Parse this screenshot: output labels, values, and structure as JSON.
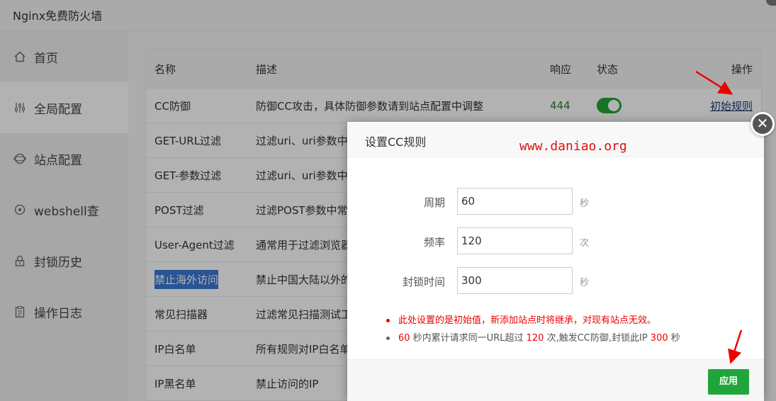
{
  "window": {
    "title": "Nginx免费防火墙"
  },
  "sidebar": {
    "items": [
      {
        "label": "首页",
        "icon": "home-icon"
      },
      {
        "label": "全局配置",
        "icon": "sliders-icon",
        "active": true
      },
      {
        "label": "站点配置",
        "icon": "globe-icon"
      },
      {
        "label": "webshell查",
        "icon": "crosshair-icon"
      },
      {
        "label": "封锁历史",
        "icon": "lock-history-icon"
      },
      {
        "label": "操作日志",
        "icon": "clipboard-icon"
      }
    ]
  },
  "table": {
    "headers": {
      "name": "名称",
      "desc": "描述",
      "resp": "响应",
      "state": "状态",
      "op": "操作"
    },
    "rows": [
      {
        "name": "CC防御",
        "desc": "防御CC攻击，具体防御参数请到站点配置中调整",
        "resp": "444",
        "state": "on",
        "op": "初始规则"
      },
      {
        "name": "GET-URL过滤",
        "desc": "过滤uri、uri参数中"
      },
      {
        "name": "GET-参数过滤",
        "desc": "过滤uri、uri参数中"
      },
      {
        "name": "POST过滤",
        "desc": "过滤POST参数中常"
      },
      {
        "name": "User-Agent过滤",
        "desc": "通常用于过滤浏览器"
      },
      {
        "name": "禁止海外访问",
        "desc": "禁止中国大陆以外的"
      },
      {
        "name": "常见扫描器",
        "desc": "过滤常见扫描测试工"
      },
      {
        "name": "IP白名单",
        "desc": "所有规则对IP白名单"
      },
      {
        "name": "IP黑名单",
        "desc": "禁止访问的IP"
      }
    ]
  },
  "dialog": {
    "title": "设置CC规则",
    "watermark": "www.daniao.org",
    "close": "✕",
    "fields": {
      "period": {
        "label": "周期",
        "value": "60",
        "unit": "秒"
      },
      "freq": {
        "label": "频率",
        "value": "120",
        "unit": "次"
      },
      "block": {
        "label": "封锁时间",
        "value": "300",
        "unit": "秒"
      }
    },
    "note1": "此处设置的是初始值，新添加站点时将继承，对现有站点无效。",
    "note2": {
      "n1": "60",
      "t1": " 秒内累计请求同一URL超过 ",
      "n2": "120",
      "t2": " 次,触发CC防御,封锁此IP ",
      "n3": "300",
      "t3": " 秒"
    },
    "apply": "应用"
  },
  "colors": {
    "accent_green": "#20a53a",
    "annotation_red": "#e00000"
  }
}
